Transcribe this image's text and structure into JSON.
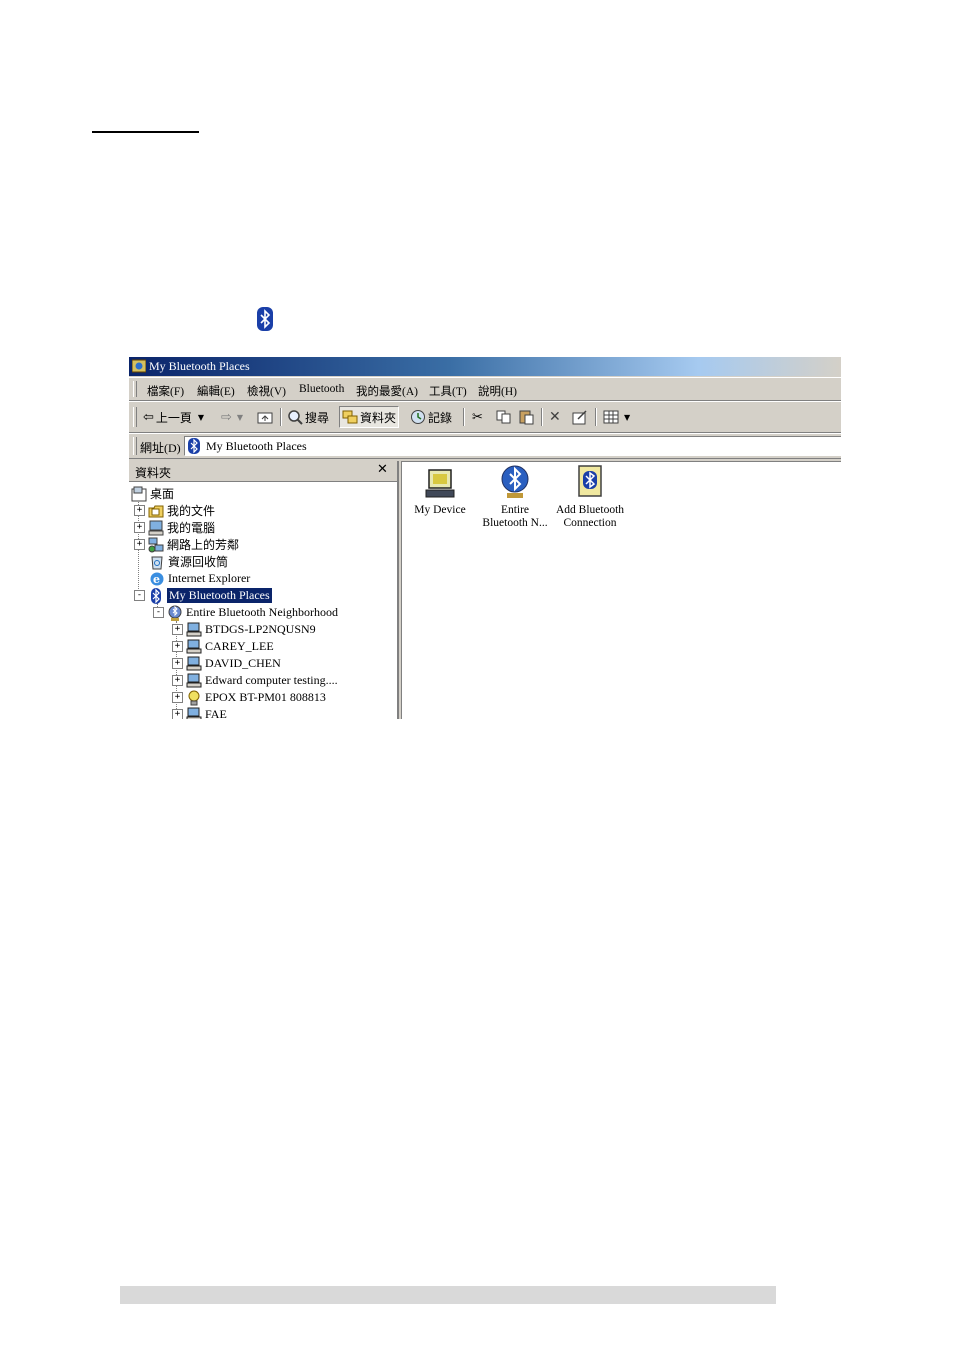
{
  "window": {
    "title": "My Bluetooth Places",
    "menu": [
      "檔案(F)",
      "編輯(E)",
      "檢視(V)",
      "Bluetooth",
      "我的最愛(A)",
      "工具(T)",
      "說明(H)"
    ],
    "toolbar": {
      "back": "上一頁",
      "search": "搜尋",
      "folders": "資料夾",
      "history": "記錄"
    },
    "address": {
      "label": "網址(D)",
      "value": "My Bluetooth Places"
    },
    "folders_pane": {
      "title": "資料夾",
      "close": "✕",
      "items": [
        "桌面",
        "我的文件",
        "我的電腦",
        "網路上的芳鄰",
        "資源回收筒",
        "Internet Explorer",
        "My Bluetooth Places",
        "Entire Bluetooth Neighborhood",
        "BTDGS-LP2NQUSN9",
        "CAREY_LEE",
        "DAVID_CHEN",
        "Edward computer testing....",
        "EPOX BT-PM01 808813",
        "FAE"
      ]
    },
    "content_items": [
      {
        "line1": "My Device",
        "line2": "",
        "icon": "computer-icon"
      },
      {
        "line1": "Entire",
        "line2": "Bluetooth N...",
        "icon": "bluetooth-globe-icon"
      },
      {
        "line1": "Add Bluetooth",
        "line2": "Connection",
        "icon": "add-connection-icon"
      }
    ]
  }
}
